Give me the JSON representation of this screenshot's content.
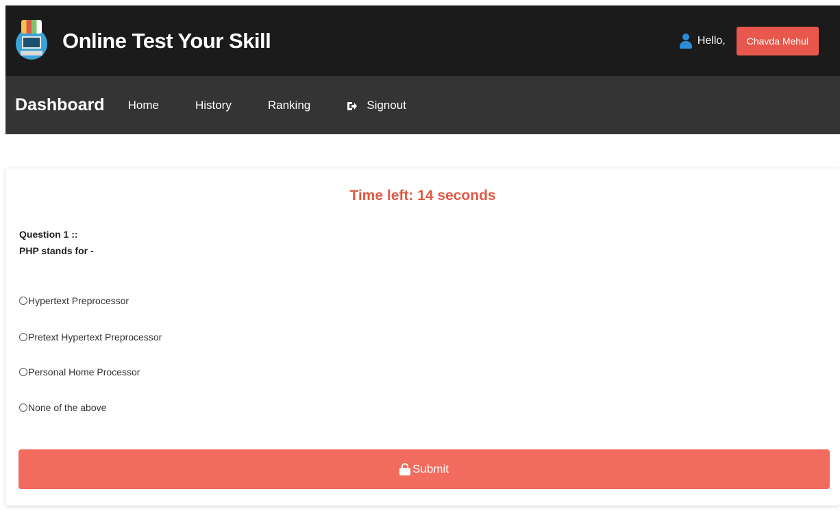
{
  "header": {
    "title": "Online Test Your Skill",
    "logo_icon": "computer-books-logo",
    "greeting": "Hello,",
    "user_name": "Chavda Mehul",
    "user_icon": "user-icon"
  },
  "nav": {
    "brand": "Dashboard",
    "items": [
      {
        "label": "Home"
      },
      {
        "label": "History"
      },
      {
        "label": "Ranking"
      },
      {
        "label": "Signout",
        "icon": "signout-icon"
      }
    ]
  },
  "quiz": {
    "timer": "Time left: 14 seconds",
    "question_number": "Question  1 ::",
    "question_text": "PHP stands for -",
    "options": [
      {
        "label": "Hypertext Preprocessor"
      },
      {
        "label": "Pretext Hypertext Preprocessor"
      },
      {
        "label": "Personal Home Processor"
      },
      {
        "label": "None of the above"
      }
    ],
    "submit_label": "Submit",
    "submit_icon": "lock-icon"
  },
  "colors": {
    "topbar_bg": "#1b1b1b",
    "navbar_bg": "#343434",
    "accent": "#e8574b",
    "submit_bg": "#f26b5f",
    "timer_text": "#e05a47"
  }
}
